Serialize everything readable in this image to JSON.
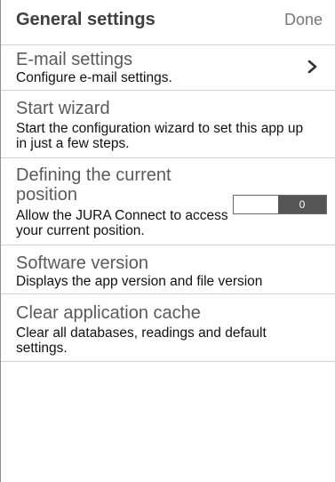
{
  "header": {
    "title": "General settings",
    "done_label": "Done"
  },
  "rows": {
    "email": {
      "title": "E-mail settings",
      "description": "Configure e-mail settings.",
      "icon": "chevron-right-icon"
    },
    "wizard": {
      "title": "Start wizard",
      "description": "Start the configuration wizard to set this app up in just a few steps."
    },
    "position": {
      "title": "Defining the current position",
      "description": "Allow the JURA Connect to access your current position.",
      "toggle_label": "0",
      "toggle_state": "off"
    },
    "software": {
      "title": "Software version",
      "description": "Displays the app version and file version"
    },
    "cache": {
      "title": "Clear application cache",
      "description": "Clear all databases, readings and default settings."
    }
  },
  "colors": {
    "title_text": "#3f3f3f",
    "row_title_text": "#5a5a5a",
    "divider": "#d2d2d2",
    "toggle_knob": "#555555"
  }
}
